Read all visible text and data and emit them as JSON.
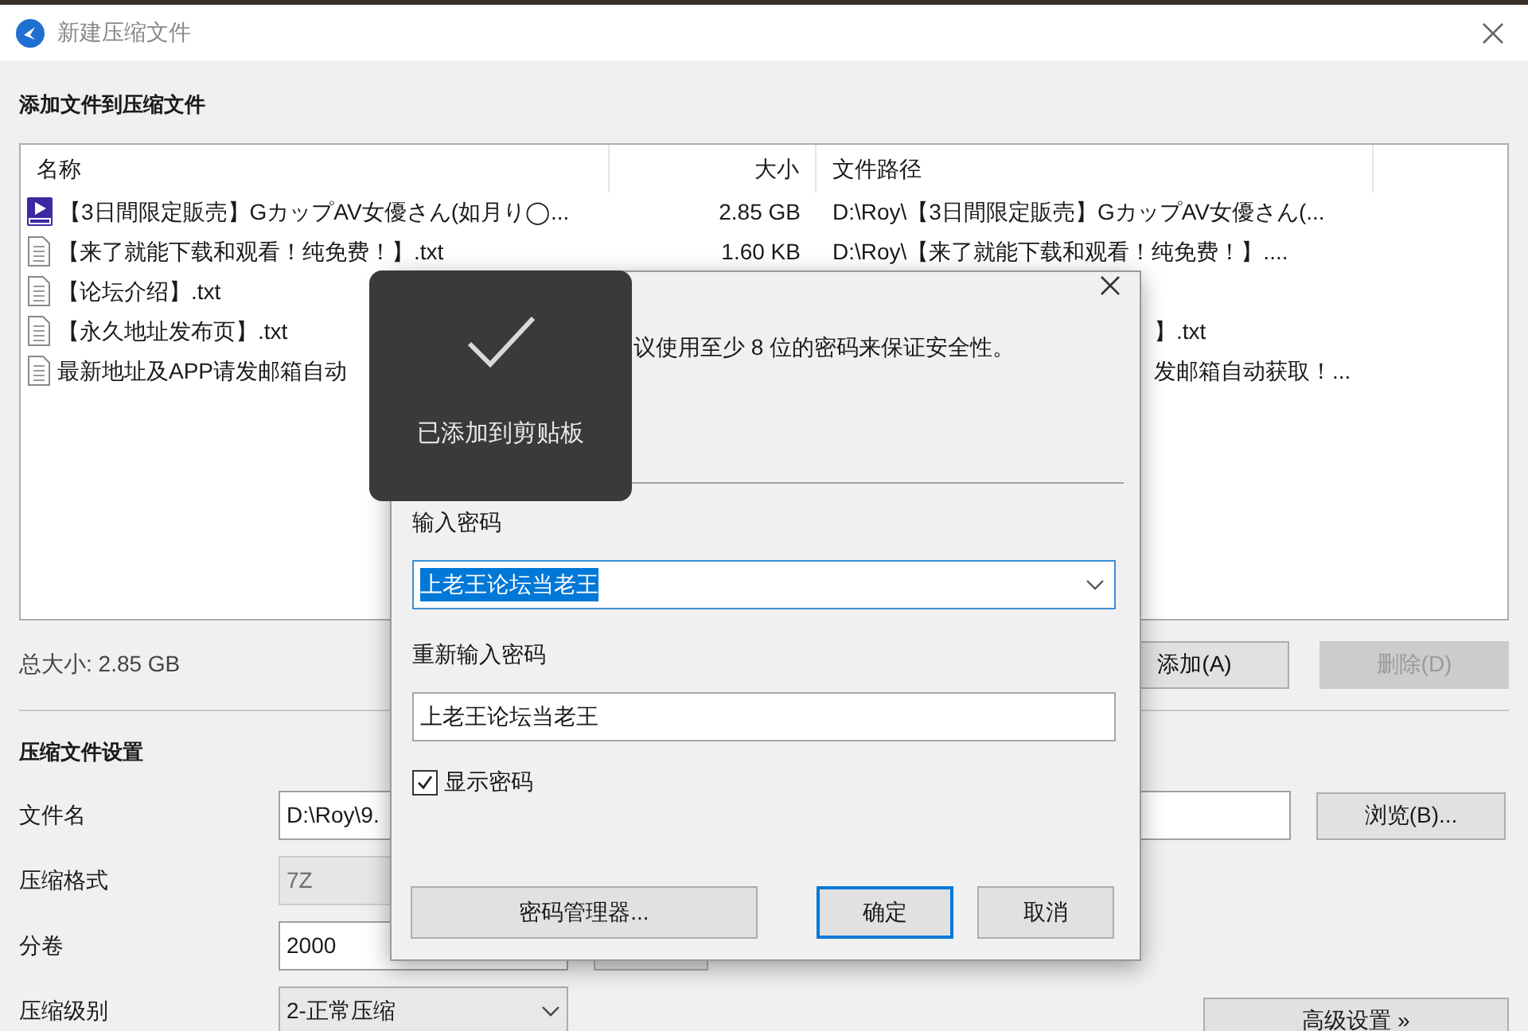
{
  "window": {
    "title": "新建压缩文件"
  },
  "files_section": {
    "title": "添加文件到压缩文件"
  },
  "file_list": {
    "columns": [
      "名称",
      "大小",
      "文件路径"
    ],
    "rows": [
      {
        "kind": "video",
        "name": "【3日間限定販売】GカップAV女優さん(如月り◯...",
        "size": "2.85 GB",
        "path": "D:\\Roy\\【3日間限定販売】GカップAV女優さん(...",
        "path_partial": false
      },
      {
        "kind": "text",
        "name": "【来了就能下载和观看！纯免费！】.txt",
        "size": "1.60 KB",
        "path": "D:\\Roy\\【来了就能下载和观看！纯免费！】....",
        "path_partial": false
      },
      {
        "kind": "text",
        "name": "【论坛介绍】.txt"
      },
      {
        "kind": "text",
        "name": "【永久地址发布页】.txt",
        "path": "】.txt",
        "path_partial": true
      },
      {
        "kind": "text",
        "name": "最新地址及APP请发邮箱自动",
        "path": "发邮箱自动获取！...",
        "path_partial": true
      }
    ]
  },
  "total_size": "总大小: 2.85 GB",
  "list_buttons": [
    {
      "label": "添加(A)",
      "disabled": false
    },
    {
      "label": "删除(D)",
      "disabled": true
    }
  ],
  "settings": {
    "title": "压缩文件设置",
    "rows": [
      {
        "kind": "text",
        "label": "文件名",
        "value": "D:\\Roy\\9.",
        "button": "浏览(B)..."
      },
      {
        "kind": "combo",
        "label": "压缩格式",
        "value": "7Z",
        "disabled": true
      },
      {
        "kind": "text",
        "label": "分卷",
        "value": "2000"
      },
      {
        "kind": "combo",
        "label": "压缩级别",
        "value": "2-正常压缩",
        "disabled": false
      }
    ]
  },
  "advanced_button": "高级设置 »",
  "password_dialog": {
    "hint": "议使用至少 8 位的密码来保证安全性。",
    "fields": [
      {
        "kind": "combo",
        "label": "输入密码",
        "value": "上老王论坛当老王",
        "text_selected": true
      },
      {
        "kind": "text",
        "label": "重新输入密码",
        "value": "上老王论坛当老王",
        "text_selected": false
      }
    ],
    "show_password": {
      "label": "显示密码",
      "checked": true
    },
    "buttons": [
      {
        "label": "密码管理器...",
        "default": false
      },
      {
        "label": "确定",
        "default": true
      },
      {
        "label": "取消",
        "default": false
      }
    ]
  },
  "toast": {
    "message": "已添加到剪贴板"
  }
}
